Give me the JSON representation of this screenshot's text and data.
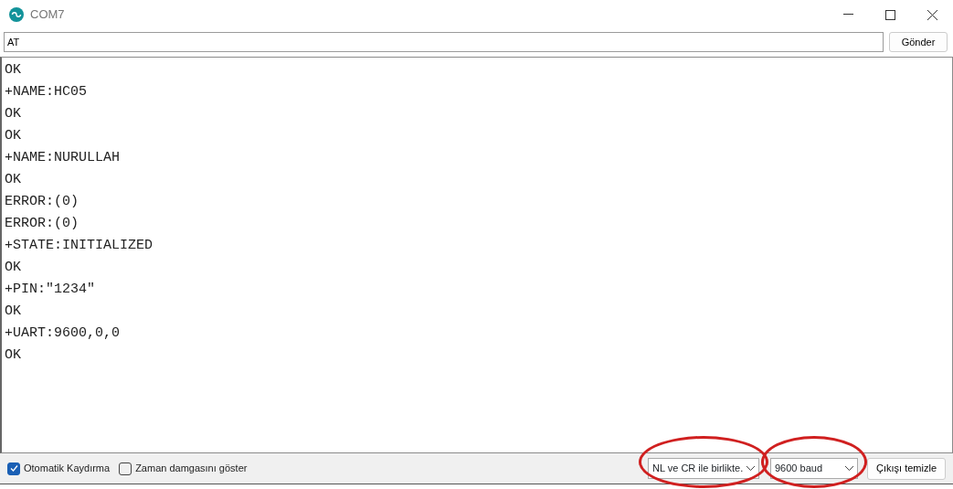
{
  "window": {
    "title": "COM7"
  },
  "input": {
    "value": "AT",
    "button": "Gönder"
  },
  "output": [
    "OK",
    "+NAME:HC05",
    "OK",
    "OK",
    "+NAME:NURULLAH",
    "OK",
    "ERROR:(0)",
    "ERROR:(0)",
    "+STATE:INITIALIZED",
    "OK",
    "+PIN:\"1234\"",
    "OK",
    "+UART:9600,0,0",
    "OK"
  ],
  "options": [
    {
      "label": "Otomatik Kaydırma",
      "checked": true
    },
    {
      "label": "Zaman damgasını göster",
      "checked": false
    }
  ],
  "dropdowns": [
    {
      "value": "NL ve CR ile birlikte.",
      "highlighted": true
    },
    {
      "value": "9600 baud",
      "highlighted": true
    }
  ],
  "clear_button": "Çıkışı temizle"
}
